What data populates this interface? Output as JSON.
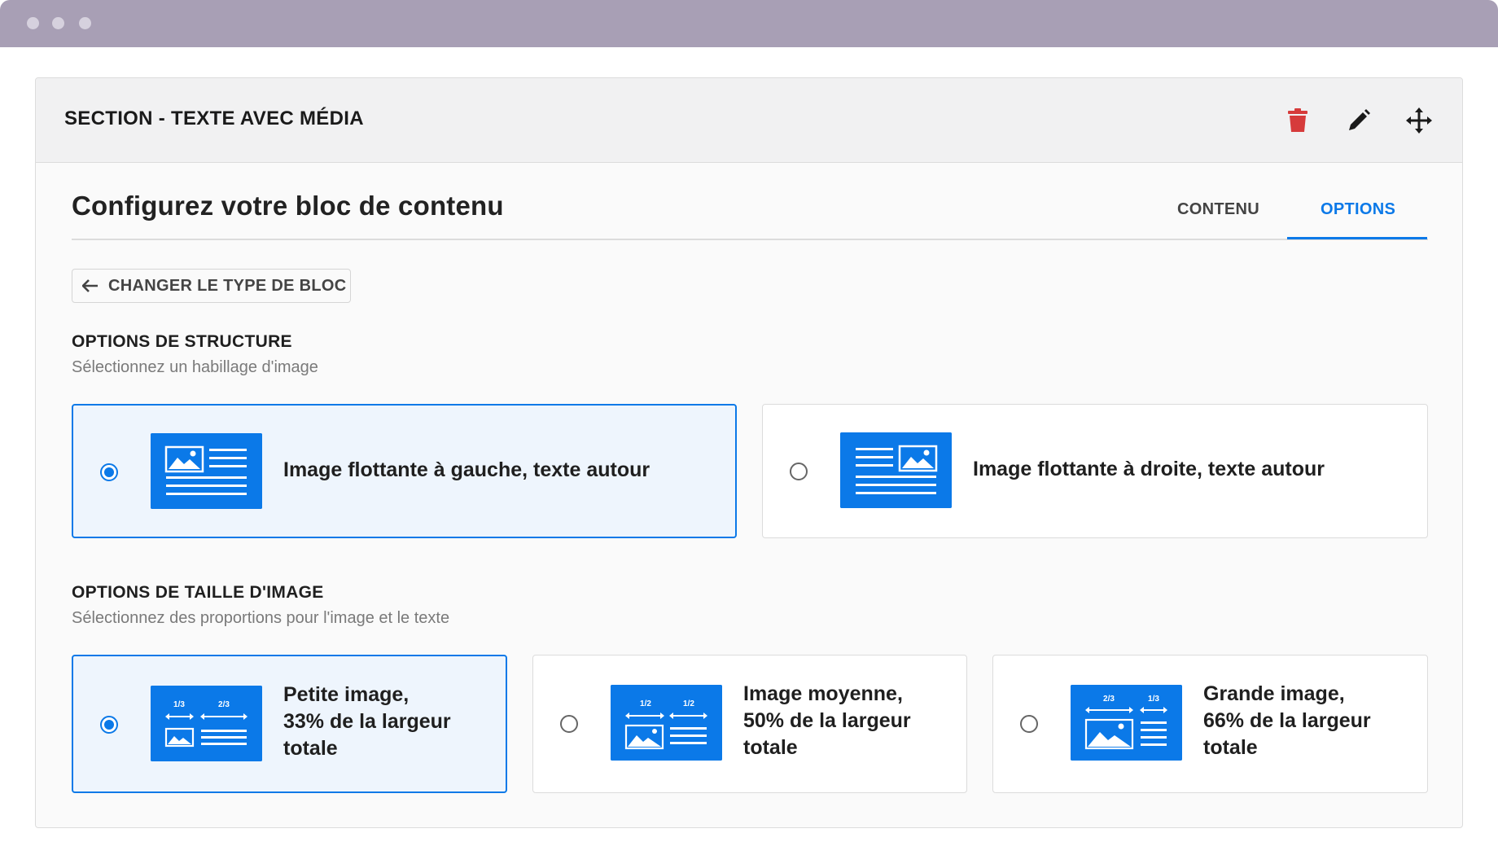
{
  "window": {
    "controls": [
      "close",
      "minimize",
      "maximize"
    ]
  },
  "section": {
    "title": "SECTION - TEXTE AVEC MÉDIA",
    "actions": [
      "trash-icon",
      "pencil-icon",
      "move-icon"
    ],
    "colors": {
      "delete": "#d63b3b",
      "accent": "#0b79e8"
    }
  },
  "config": {
    "title": "Configurez votre bloc de contenu",
    "tabs": [
      {
        "label": "CONTENU",
        "active": false
      },
      {
        "label": "OPTIONS",
        "active": true
      }
    ],
    "change_type_label": "CHANGER LE TYPE DE BLOC"
  },
  "structure": {
    "title": "OPTIONS DE STRUCTURE",
    "subtitle": "Sélectionnez un habillage d'image",
    "options": [
      {
        "label": "Image flottante à gauche, texte autour",
        "selected": true
      },
      {
        "label": "Image flottante à droite, texte autour",
        "selected": false
      }
    ]
  },
  "size": {
    "title": "OPTIONS DE TAILLE D'IMAGE",
    "subtitle": "Sélectionnez des proportions pour l'image et le texte",
    "options": [
      {
        "line1": "Petite image,",
        "line2": "33% de la largeur",
        "line3": "totale",
        "ratio_left": "1/3",
        "ratio_right": "2/3",
        "selected": true
      },
      {
        "line1": "Image moyenne,",
        "line2": "50% de la largeur",
        "line3": "totale",
        "ratio_left": "1/2",
        "ratio_right": "1/2",
        "selected": false
      },
      {
        "line1": "Grande image,",
        "line2": "66% de la largeur",
        "line3": "totale",
        "ratio_left": "2/3",
        "ratio_right": "1/3",
        "selected": false
      }
    ]
  }
}
